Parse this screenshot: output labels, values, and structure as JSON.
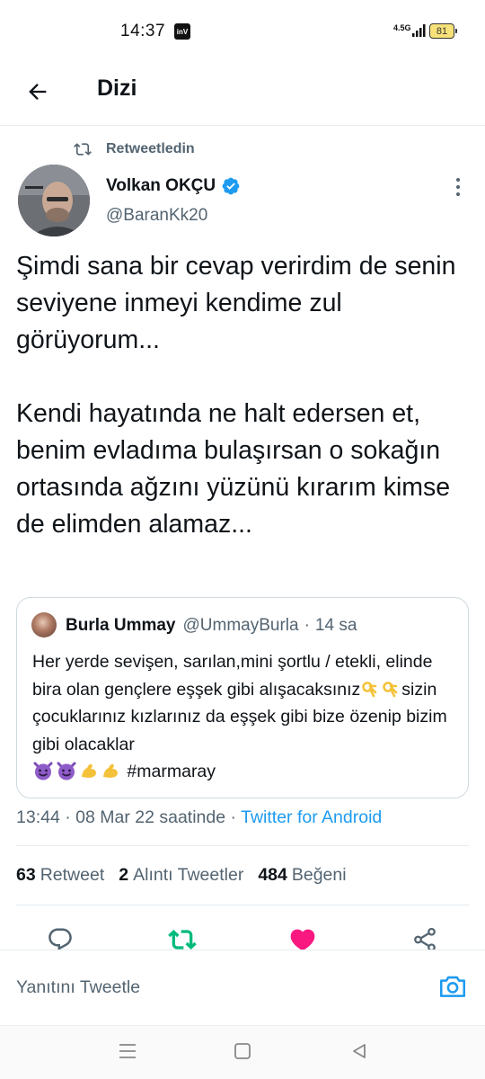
{
  "status_bar": {
    "time": "14:37",
    "app_badge": "inV",
    "network": "4.5G",
    "battery": "81"
  },
  "header": {
    "title": "Dizi"
  },
  "retweet": {
    "label": "Retweetledin"
  },
  "tweet": {
    "author_name": "Volkan OKÇU",
    "author_handle": "@BaranKk20",
    "text": "Şimdi sana bir cevap verirdim de senin seviyene inmeyi kendime zul görüyorum...\n\nKendi hayatında ne halt edersen et, benim evladıma bulaşırsan o sokağın ortasında ağzını yüzünü kırarım kimse de elimden alamaz...",
    "time": "13:44",
    "date": "08 Mar 22 saatinde",
    "separator": "·",
    "source": "Twitter for Android"
  },
  "quote": {
    "name": "Burla Ummay",
    "handle": "@UmmayBurla",
    "separator": "·",
    "time": "14 sa",
    "text_part1": "Her yerde sevişen, sarılan,mini şortlu / etekli, elinde bira olan gençlere eşşek gibi alışacaksınız",
    "text_part2": "sizin çocuklarınız kızlarınız da eşşek gibi bize özenip bizim gibi olacaklar",
    "hashtag": "#marmaray"
  },
  "stats": {
    "retweet_count": "63",
    "retweet_label": "Retweet",
    "quote_count": "2",
    "quote_label": "Alıntı Tweetler",
    "like_count": "484",
    "like_label": "Beğeni"
  },
  "reply_bar": {
    "placeholder": "Yanıtını Tweetle"
  },
  "colors": {
    "accent": "#1d9bf0",
    "retweet_green": "#00ba7c",
    "like_pink": "#f91880",
    "text_secondary": "#536471"
  },
  "icons": {
    "back": "arrow-left-icon",
    "retweet": "retweet-icon",
    "verified": "verified-badge-icon",
    "more": "more-vertical-icon",
    "reply": "reply-icon",
    "like": "heart-icon",
    "share": "share-icon",
    "camera": "camera-icon"
  }
}
